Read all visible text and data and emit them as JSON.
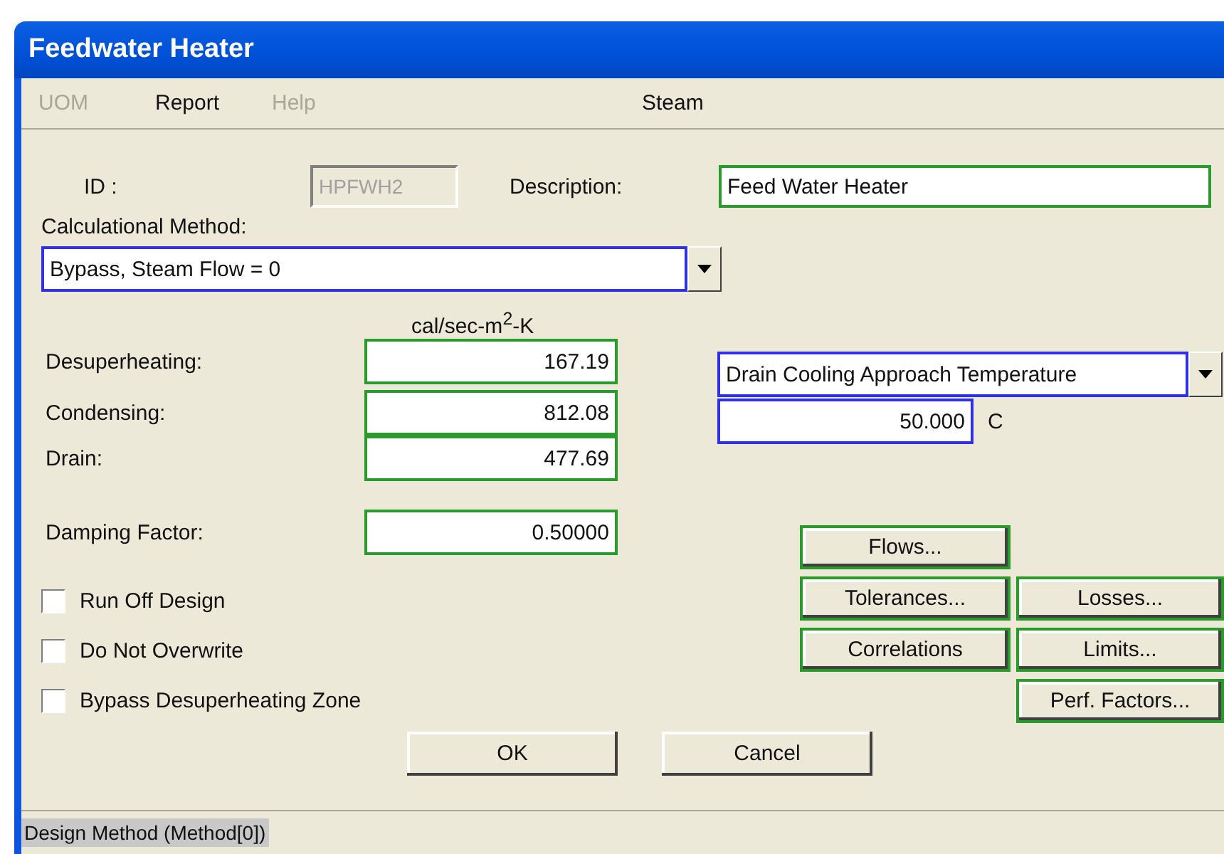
{
  "window": {
    "title": "Feedwater Heater"
  },
  "menu": [
    {
      "label": "UOM",
      "disabled": true
    },
    {
      "label": "Report",
      "disabled": false
    },
    {
      "label": "Help",
      "disabled": true
    }
  ],
  "menu_right": "Steam",
  "id": {
    "label": "ID :",
    "value": "HPFWH2",
    "disabled": true
  },
  "description": {
    "label": "Description:",
    "value": "Feed Water Heater"
  },
  "method": {
    "label": "Calculational Method:",
    "value": "Bypass, Steam Flow = 0"
  },
  "unit": "cal/sec-m$^{2}$-K",
  "coefficients": [
    {
      "label": "Desuperheating:",
      "value": "167.19"
    },
    {
      "label": "Condensing:",
      "value": "812.08"
    },
    {
      "label": "Drain:",
      "value": "477.69"
    }
  ],
  "damping": {
    "label": "Damping Factor:",
    "value": "0.50000"
  },
  "drain_option": {
    "value": "Drain Cooling Approach Temperature"
  },
  "drain_value": {
    "value": "50.000",
    "unit": "C"
  },
  "checkboxes": [
    {
      "label": "Run Off Design",
      "checked": false
    },
    {
      "label": "Do Not Overwrite",
      "checked": false
    },
    {
      "label": "Bypass Desuperheating Zone",
      "checked": false
    }
  ],
  "side_buttons": [
    {
      "label": "Flows..."
    },
    {
      "label": "Tolerances..."
    },
    {
      "label": "Losses..."
    },
    {
      "label": "Correlations"
    },
    {
      "label": "Limits..."
    },
    {
      "label": "Perf. Factors..."
    }
  ],
  "buttons": [
    "OK",
    "Cancel"
  ],
  "status_bar": "Design Method (Method[0])"
}
